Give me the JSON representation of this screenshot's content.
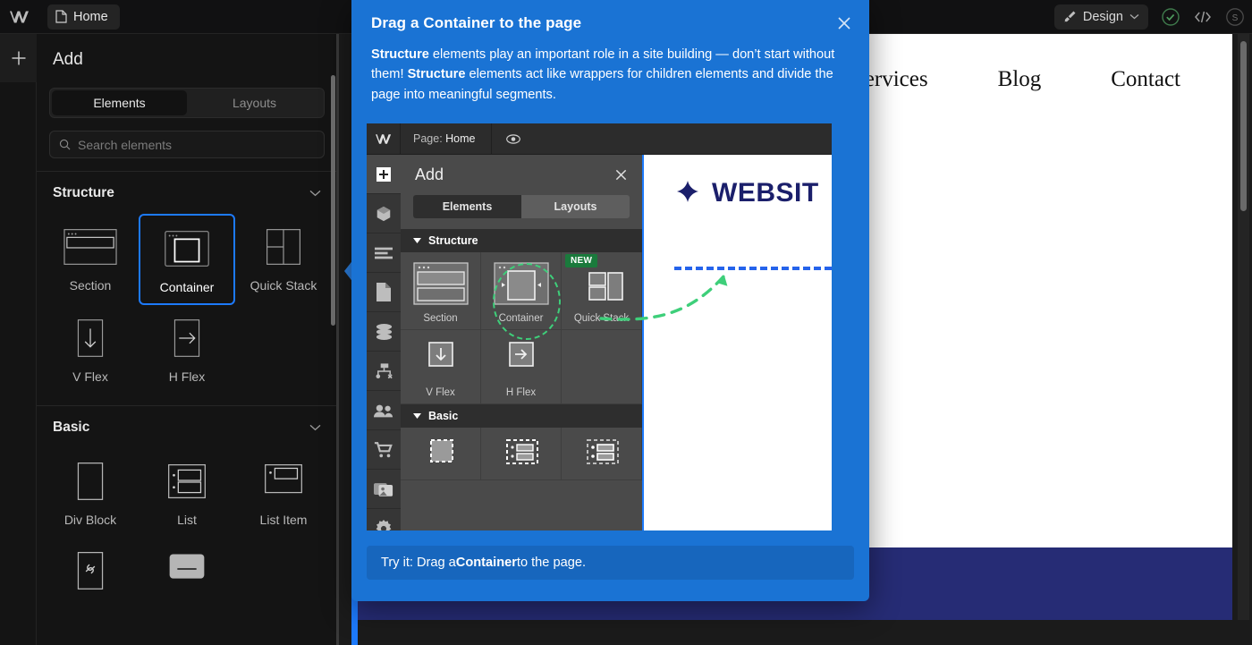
{
  "topbar": {
    "logo_icon": "webflow-logo-icon",
    "home_tab": {
      "label": "Home",
      "icon": "page-icon"
    },
    "design_pill": {
      "label": "Design",
      "icon": "paintbrush-icon",
      "chevron": "chevron-down-icon"
    },
    "status_icon": "check-circle-icon",
    "code_icon": "code-brackets-icon"
  },
  "rail": {
    "add_icon": "plus-icon"
  },
  "add_panel": {
    "title": "Add",
    "tabs": [
      {
        "label": "Elements",
        "active": true
      },
      {
        "label": "Layouts",
        "active": false
      }
    ],
    "search": {
      "placeholder": "Search elements",
      "icon": "search-icon"
    },
    "sections": [
      {
        "title": "Structure",
        "chevron": "chevron-down-icon",
        "items": [
          {
            "label": "Section",
            "icon": "section-icon",
            "selected": false
          },
          {
            "label": "Container",
            "icon": "container-icon",
            "selected": true
          },
          {
            "label": "Quick Stack",
            "icon": "quick-stack-icon",
            "selected": false
          },
          {
            "label": "V Flex",
            "icon": "arrow-down-icon",
            "selected": false
          },
          {
            "label": "H Flex",
            "icon": "arrow-right-icon",
            "selected": false
          }
        ]
      },
      {
        "title": "Basic",
        "chevron": "chevron-down-icon",
        "items": [
          {
            "label": "Div Block",
            "icon": "div-block-icon",
            "selected": false
          },
          {
            "label": "List",
            "icon": "list-icon",
            "selected": false
          },
          {
            "label": "List Item",
            "icon": "list-item-icon",
            "selected": false
          }
        ]
      }
    ]
  },
  "canvas": {
    "nav_links": [
      "Services",
      "Blog",
      "Contact"
    ]
  },
  "modal": {
    "title": "Drag a Container to the page",
    "close_icon": "close-icon",
    "body": {
      "part1_bold": "Structure",
      "part1": " elements play an important role in a site building — don’t start without them! ",
      "part2_bold": "Structure",
      "part2": " elements act like wrappers for children elements and divide the page into meaningful segments."
    },
    "tryit": {
      "prefix": "Try it: Drag a ",
      "bold": "Container",
      "suffix": " to the page."
    },
    "screenshot": {
      "topbar": {
        "logo_icon": "webflow-logo-icon",
        "page_prefix": "Page:",
        "page_name": "Home",
        "eye_icon": "eye-icon"
      },
      "rail_icons": [
        "plus-icon",
        "box-icon",
        "layers-icon",
        "page-icon",
        "database-icon",
        "sitemap-icon",
        "users-icon",
        "cart-icon",
        "media-icon",
        "settings-icon"
      ],
      "panel": {
        "title": "Add",
        "close_icon": "close-icon",
        "tabs": [
          {
            "label": "Elements",
            "active": true
          },
          {
            "label": "Layouts",
            "active": false
          }
        ],
        "sections": [
          {
            "title": "Structure",
            "chevron": "triangle-down-icon",
            "items": [
              {
                "label": "Section",
                "badge": ""
              },
              {
                "label": "Container",
                "badge": ""
              },
              {
                "label": "Quick Stack",
                "badge": "NEW"
              },
              {
                "label": "V Flex",
                "badge": ""
              },
              {
                "label": "H Flex",
                "badge": ""
              }
            ]
          },
          {
            "title": "Basic",
            "chevron": "triangle-down-icon",
            "items": [
              {
                "label": "",
                "badge": ""
              },
              {
                "label": "",
                "badge": ""
              },
              {
                "label": "",
                "badge": ""
              }
            ]
          }
        ]
      },
      "preview": {
        "logo_icon": "sparkle-icon",
        "logo_text": "WEBSIT"
      }
    }
  },
  "colors": {
    "modal_blue": "#1a73d4",
    "accent_blue": "#1d7afc",
    "highlight_green": "#3ecf7a",
    "badge_green": "#1a7a3c",
    "site_navy": "#262c75"
  }
}
